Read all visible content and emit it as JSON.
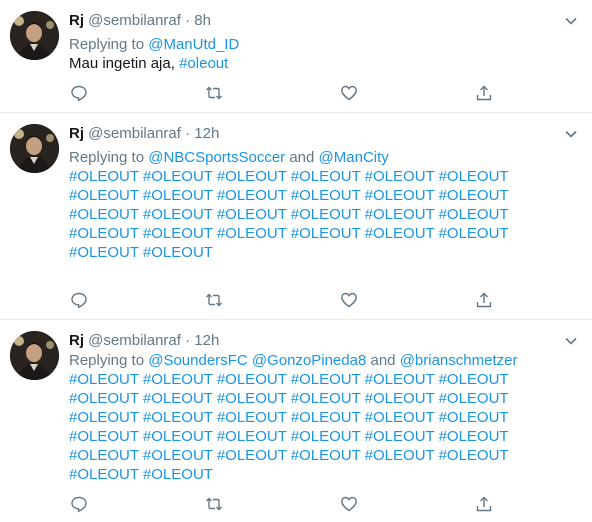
{
  "tweets": [
    {
      "name": "Rj",
      "handle": "@sembilanraf",
      "separator": "·",
      "time": "8h",
      "replying_prefix": "Replying to",
      "replying_to": [
        "@ManUtd_ID"
      ],
      "replying_joiners": [],
      "text": "Mau ingetin aja,",
      "hashtags": [
        "#oleout"
      ]
    },
    {
      "name": "Rj",
      "handle": "@sembilanraf",
      "separator": "·",
      "time": "12h",
      "replying_prefix": "Replying to",
      "replying_to": [
        "@NBCSportsSoccer",
        "@ManCity"
      ],
      "replying_joiners": [
        "and"
      ],
      "text": "",
      "hashtag_lines": [
        "#OLEOUT #OLEOUT #OLEOUT #OLEOUT #OLEOUT #OLEOUT",
        "#OLEOUT #OLEOUT #OLEOUT #OLEOUT #OLEOUT #OLEOUT",
        "#OLEOUT #OLEOUT #OLEOUT #OLEOUT #OLEOUT #OLEOUT",
        "#OLEOUT #OLEOUT #OLEOUT #OLEOUT #OLEOUT #OLEOUT",
        "#OLEOUT #OLEOUT"
      ]
    },
    {
      "name": "Rj",
      "handle": "@sembilanraf",
      "separator": "·",
      "time": "12h",
      "replying_prefix": "Replying to",
      "replying_to": [
        "@SoundersFC",
        "@GonzoPineda8",
        "@brianschmetzer"
      ],
      "replying_joiners": [
        "",
        "and"
      ],
      "text": "",
      "hashtag_lines": [
        "#OLEOUT #OLEOUT #OLEOUT #OLEOUT #OLEOUT #OLEOUT",
        "#OLEOUT #OLEOUT #OLEOUT #OLEOUT #OLEOUT #OLEOUT",
        "#OLEOUT #OLEOUT #OLEOUT #OLEOUT #OLEOUT #OLEOUT",
        "#OLEOUT #OLEOUT #OLEOUT #OLEOUT #OLEOUT #OLEOUT",
        "#OLEOUT #OLEOUT #OLEOUT #OLEOUT #OLEOUT #OLEOUT",
        "#OLEOUT #OLEOUT"
      ]
    }
  ],
  "icons": [
    "reply-icon",
    "retweet-icon",
    "like-icon",
    "share-icon",
    "chevron-down-icon"
  ],
  "colors": {
    "link": "#1b95e0",
    "muted": "#657786",
    "text": "#14171a",
    "divider": "#e6ecf0"
  }
}
